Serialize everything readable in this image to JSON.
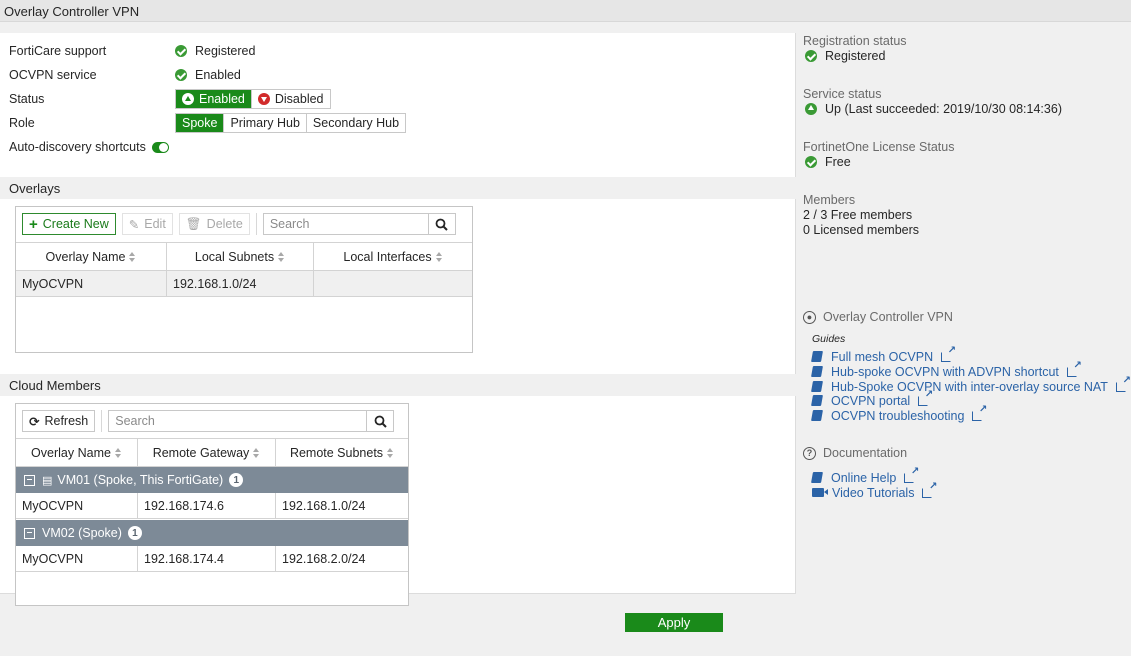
{
  "window": {
    "title": "Overlay Controller VPN"
  },
  "settings": {
    "forticare": {
      "label": "FortiCare support",
      "value": "Registered"
    },
    "ocvpn_service": {
      "label": "OCVPN service",
      "value": "Enabled"
    },
    "status": {
      "label": "Status",
      "options": [
        "Enabled",
        "Disabled"
      ],
      "selected": "Enabled"
    },
    "role": {
      "label": "Role",
      "options": [
        "Spoke",
        "Primary Hub",
        "Secondary Hub"
      ],
      "selected": "Spoke"
    },
    "auto_discovery": {
      "label": "Auto-discovery shortcuts",
      "enabled": true
    }
  },
  "overlays": {
    "section_title": "Overlays",
    "toolbar": {
      "create_label": "Create New",
      "edit_label": "Edit",
      "delete_label": "Delete",
      "search_placeholder": "Search"
    },
    "columns": [
      "Overlay Name",
      "Local Subnets",
      "Local Interfaces"
    ],
    "rows": [
      {
        "overlay_name": "MyOCVPN",
        "local_subnets": "192.168.1.0/24",
        "local_interfaces": ""
      }
    ]
  },
  "cloud_members": {
    "section_title": "Cloud Members",
    "toolbar": {
      "refresh_label": "Refresh",
      "search_placeholder": "Search"
    },
    "columns": [
      "Overlay Name",
      "Remote Gateway",
      "Remote Subnets"
    ],
    "groups": [
      {
        "name": "VM01 (Spoke, This FortiGate)",
        "count": "1",
        "rows": [
          {
            "overlay_name": "MyOCVPN",
            "remote_gateway": "192.168.174.6",
            "remote_subnets": "192.168.1.0/24"
          }
        ]
      },
      {
        "name": "VM02 (Spoke)",
        "count": "1",
        "rows": [
          {
            "overlay_name": "MyOCVPN",
            "remote_gateway": "192.168.174.4",
            "remote_subnets": "192.168.2.0/24"
          }
        ]
      }
    ]
  },
  "info_panel": {
    "registration": {
      "label": "Registration status",
      "value": "Registered"
    },
    "service": {
      "label": "Service status",
      "value": "Up (Last succeeded: 2019/10/30 08:14:36)"
    },
    "license": {
      "label": "FortinetOne License Status",
      "value": "Free"
    },
    "members": {
      "label": "Members",
      "line1": "2 / 3 Free members",
      "line2": "0 Licensed members"
    }
  },
  "help": {
    "ocvpn_heading": "Overlay Controller VPN",
    "guides_label": "Guides",
    "guides": [
      "Full mesh OCVPN",
      "Hub-spoke OCVPN with ADVPN shortcut",
      "Hub-Spoke OCVPN with inter-overlay source NAT",
      "OCVPN portal",
      "OCVPN troubleshooting"
    ],
    "documentation_heading": "Documentation",
    "documentation": [
      "Online Help",
      "Video Tutorials"
    ]
  },
  "footer": {
    "apply_label": "Apply"
  },
  "colors": {
    "accent_green": "#1a8a1a",
    "link_blue": "#2b63a7",
    "group_row": "#7d8a97",
    "error_red": "#d12b2b"
  }
}
